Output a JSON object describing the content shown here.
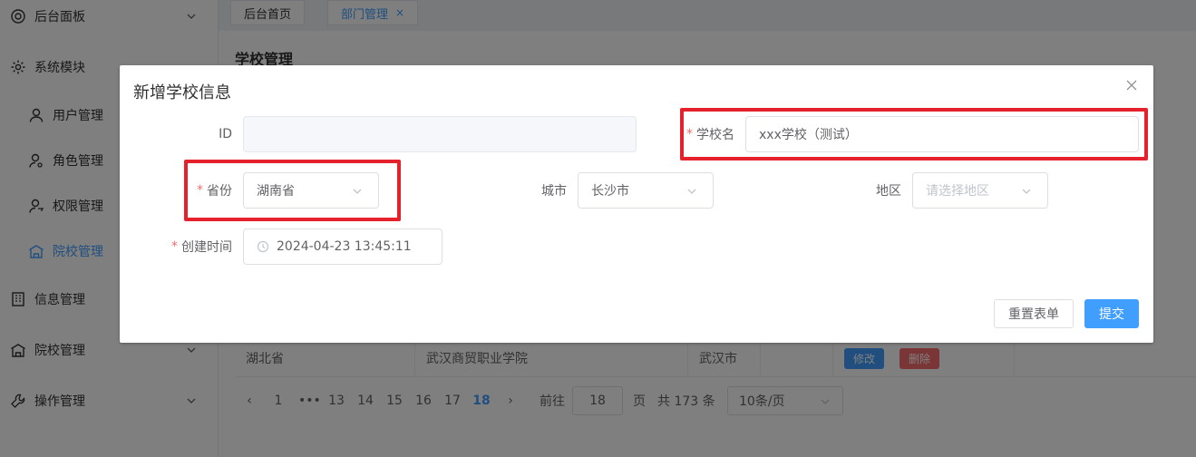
{
  "sidebar": {
    "items": [
      {
        "label": "后台面板",
        "icon": "dashboard-icon",
        "arrow": true
      },
      {
        "label": "系统模块",
        "icon": "gear-icon",
        "arrow": false
      },
      {
        "label": "用户管理",
        "icon": "user-icon"
      },
      {
        "label": "角色管理",
        "icon": "user-gear-icon"
      },
      {
        "label": "权限管理",
        "icon": "user-key-icon"
      },
      {
        "label": "院校管理",
        "icon": "school-icon",
        "active": true
      },
      {
        "label": "信息管理",
        "icon": "building-icon",
        "arrow": false
      },
      {
        "label": "院校管理",
        "icon": "school-icon",
        "arrow": true
      },
      {
        "label": "操作管理",
        "icon": "wrench-icon",
        "arrow": true
      }
    ]
  },
  "tabs": [
    {
      "label": "后台首页",
      "active": false
    },
    {
      "label": "部门管理",
      "active": true,
      "close": "×"
    }
  ],
  "card": {
    "title": "学校管理",
    "row": {
      "province": "湖北省",
      "school": "武汉商贸职业学院",
      "city": "武汉市",
      "edit": "修改",
      "delete": "删除"
    }
  },
  "pagination": {
    "prev": "‹",
    "pages": [
      "1",
      "•••",
      "13",
      "14",
      "15",
      "16",
      "17",
      "18"
    ],
    "current": "18",
    "next": "›",
    "goto_label": "前往",
    "goto_value": "18",
    "page_unit": "页",
    "total": "共 173 条",
    "page_size": "10条/页"
  },
  "dialog": {
    "title": "新增学校信息",
    "close": "×",
    "fields": {
      "id": {
        "label": "ID",
        "value": ""
      },
      "school_name": {
        "label": "学校名",
        "value": "xxx学校（测试）",
        "required": "*"
      },
      "province": {
        "label": "省份",
        "value": "湖南省",
        "required": "*"
      },
      "city": {
        "label": "城市",
        "value": "长沙市"
      },
      "district": {
        "label": "地区",
        "placeholder": "请选择地区"
      },
      "created_at": {
        "label": "创建时间",
        "value": "2024-04-23 13:45:11",
        "required": "*"
      }
    },
    "reset_label": "重置表单",
    "submit_label": "提交"
  },
  "colors": {
    "primary": "#409eff",
    "danger": "#f56c6c",
    "highlight": "#e5212b"
  }
}
